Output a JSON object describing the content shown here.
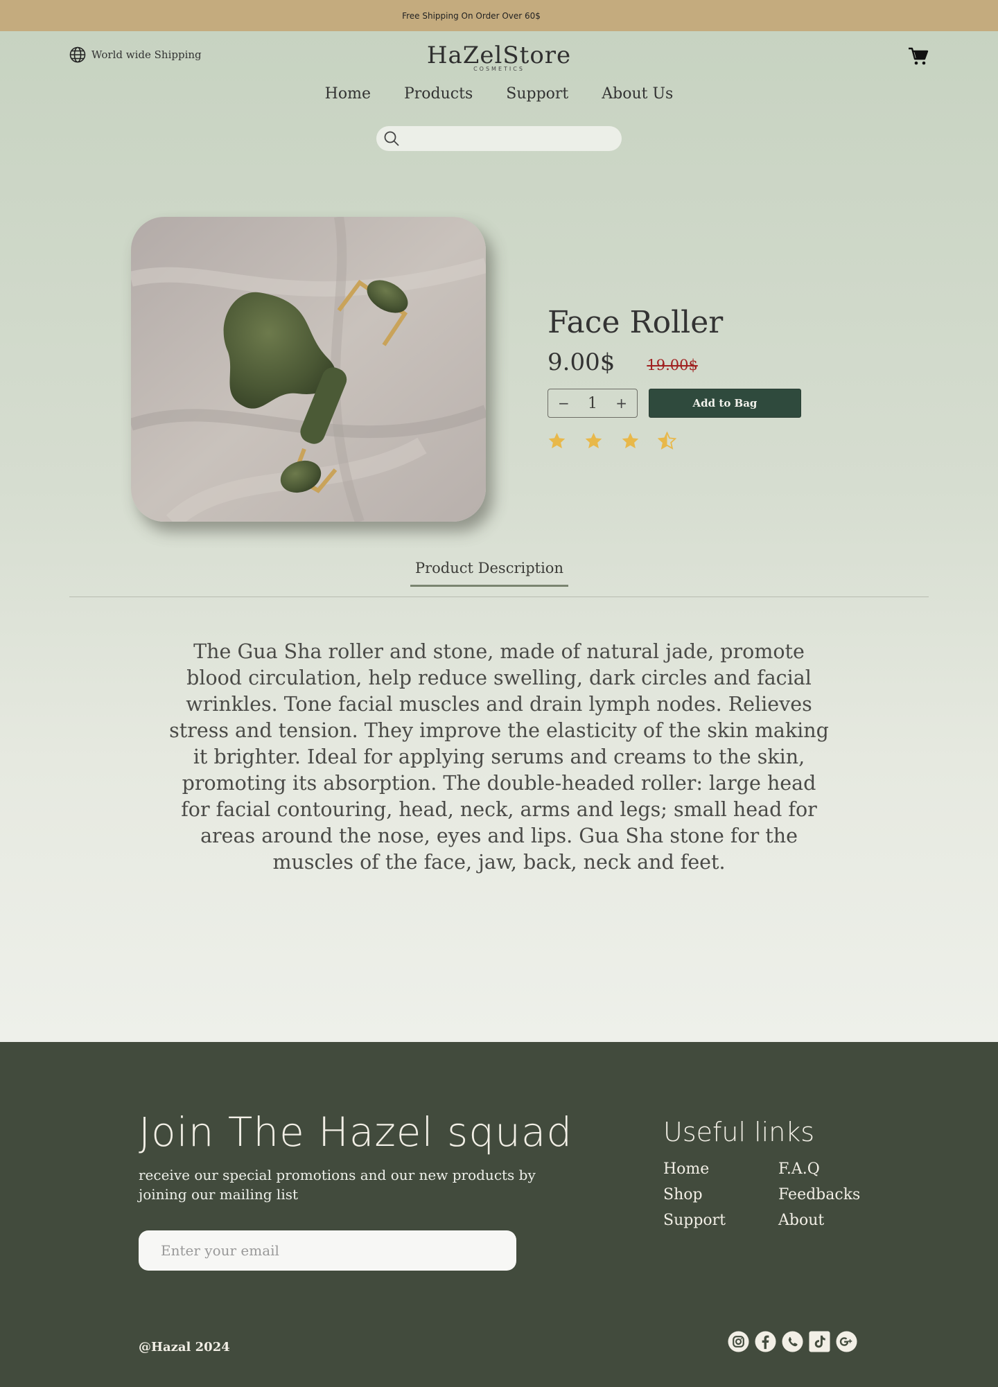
{
  "announcement": "Free Shipping On Order Over 60$",
  "header": {
    "shipping_label": "World wide Shipping",
    "logo_name": "HaZelStore",
    "logo_sub": "COSMETICS"
  },
  "nav": [
    "Home",
    "Products",
    "Support",
    "About Us"
  ],
  "search": {
    "placeholder": ""
  },
  "product": {
    "title": "Face Roller",
    "price": "9.00$",
    "old_price": "19.00$",
    "quantity": "1",
    "add_label": "Add to Bag",
    "rating": 3.5,
    "rating_max": 4
  },
  "tab_label": "Product Description",
  "description": "The Gua Sha roller and stone, made of natural jade, promote blood circulation, help reduce swelling, dark circles and facial wrinkles. Tone facial muscles and drain lymph nodes. Relieves stress and tension. They improve the elasticity of the skin making it brighter. Ideal for applying serums and creams to the skin, promoting its absorption. The double-headed roller: large head for facial contouring, head, neck, arms and legs; small head for areas around the nose, eyes and lips. Gua Sha stone for the muscles of the face, jaw, back, neck and feet.",
  "footer": {
    "join_title": "Join The Hazel squad",
    "join_sub": "receive our special promotions and our new products by joining our mailing list",
    "email_placeholder": "Enter your email",
    "links_title": "Useful links",
    "links": [
      "Home",
      "F.A.Q",
      "Shop",
      "Feedbacks",
      "Support",
      "About"
    ],
    "copyright": "@Hazal 2024",
    "social_icons": [
      "instagram-icon",
      "facebook-icon",
      "whatsapp-icon",
      "tiktok-icon",
      "google-plus-icon"
    ]
  },
  "colors": {
    "topbar": "#c4ab7e",
    "button": "#2f4a3d",
    "footer": "#424b3d",
    "star": "#e8b84a",
    "old_price": "#a02020"
  }
}
